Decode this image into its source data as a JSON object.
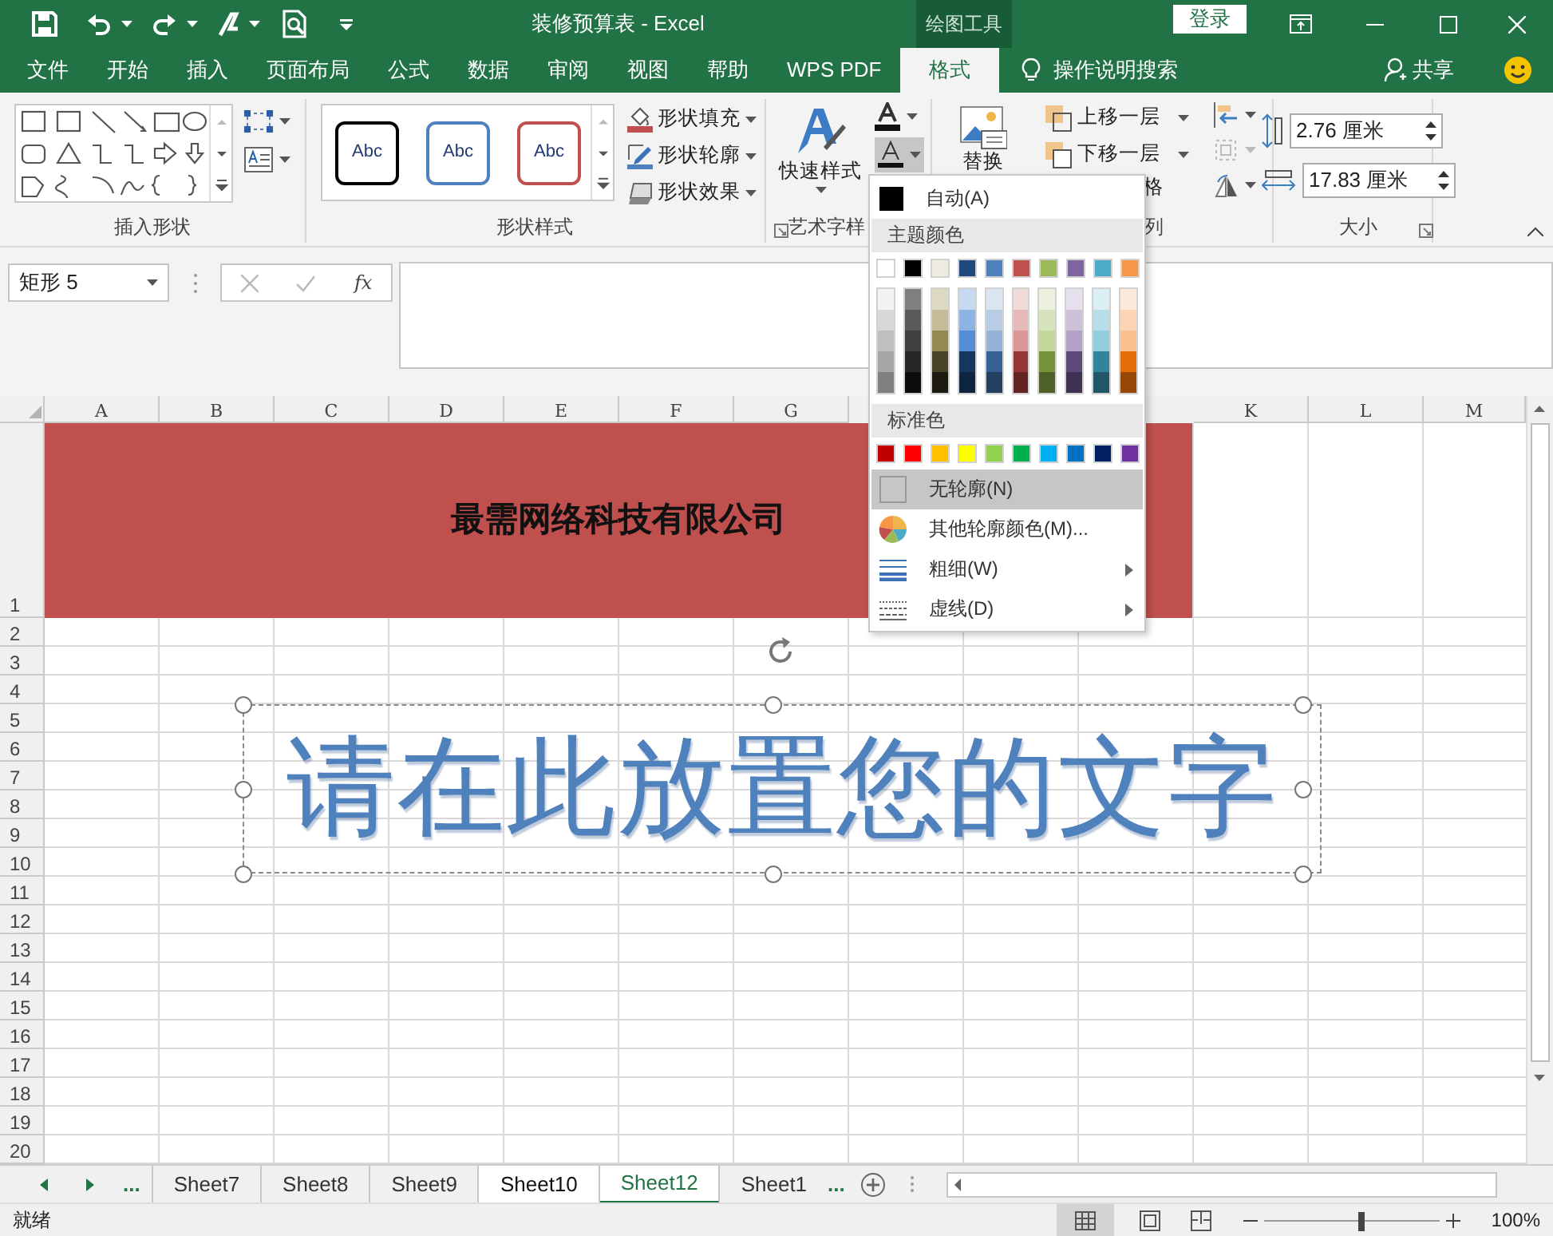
{
  "title_bar": {
    "title": "装修预算表  -  Excel",
    "context_tab": "绘图工具",
    "sign_in": "登录"
  },
  "ribbon_tabs": [
    {
      "label": "文件",
      "selected": false
    },
    {
      "label": "开始",
      "selected": false
    },
    {
      "label": "插入",
      "selected": false
    },
    {
      "label": "页面布局",
      "selected": false
    },
    {
      "label": "公式",
      "selected": false
    },
    {
      "label": "数据",
      "selected": false
    },
    {
      "label": "审阅",
      "selected": false
    },
    {
      "label": "视图",
      "selected": false
    },
    {
      "label": "帮助",
      "selected": false
    },
    {
      "label": "WPS PDF",
      "selected": false
    },
    {
      "label": "格式",
      "selected": true
    }
  ],
  "tell_me": "操作说明搜索",
  "share": "共享",
  "ribbon": {
    "insert_shapes": {
      "label": "插入形状"
    },
    "shape_styles": {
      "label": "形状样式",
      "presets": [
        {
          "text": "Abc",
          "color": "#000000"
        },
        {
          "text": "Abc",
          "color": "#4f81bd"
        },
        {
          "text": "Abc",
          "color": "#c0504d"
        }
      ],
      "commands": [
        {
          "label": "形状填充",
          "kind": "fill"
        },
        {
          "label": "形状轮廓",
          "kind": "outline"
        },
        {
          "label": "形状效果",
          "kind": "effect"
        }
      ]
    },
    "wordart": {
      "label": "艺术字样",
      "quick_styles": "快速样式"
    },
    "arrange": {
      "replace": "替换",
      "commands": [
        {
          "label": "上移一层",
          "kind": "forward"
        },
        {
          "label": "下移一层",
          "kind": "backward"
        }
      ],
      "pane_fragment": "格",
      "label": "列"
    },
    "size": {
      "label": "大小",
      "height": "2.76 厘米",
      "width": "17.83 厘米"
    }
  },
  "formula_bar": {
    "name_box": "矩形 5",
    "fx": "fx"
  },
  "sheet": {
    "columns_left": [
      "A",
      "B",
      "C",
      "D",
      "E",
      "F",
      "G"
    ],
    "columns_right": [
      "K",
      "L",
      "M"
    ],
    "rows": [
      "1",
      "2",
      "3",
      "4",
      "5",
      "6",
      "7",
      "8",
      "9",
      "10",
      "11",
      "12",
      "13",
      "14",
      "15",
      "16",
      "17",
      "18",
      "19",
      "20"
    ],
    "banner": "最需网络科技有限公司",
    "wordart_text": "请在此放置您的文字"
  },
  "outline_menu": {
    "automatic": "自动(A)",
    "theme_heading": "主题颜色",
    "theme_colors": [
      {
        "color": "#ffffff",
        "shades": [
          {
            "color": "#f2f2f2"
          },
          {
            "color": "#d8d8d8"
          },
          {
            "color": "#bfbfbf"
          },
          {
            "color": "#a5a5a5"
          },
          {
            "color": "#7f7f7f"
          }
        ]
      },
      {
        "color": "#000000",
        "shades": [
          {
            "color": "#7f7f7f"
          },
          {
            "color": "#595959"
          },
          {
            "color": "#3f3f3f"
          },
          {
            "color": "#262626"
          },
          {
            "color": "#0c0c0c"
          }
        ]
      },
      {
        "color": "#eeece1",
        "shades": [
          {
            "color": "#ddd9c3"
          },
          {
            "color": "#c4bd97"
          },
          {
            "color": "#938953"
          },
          {
            "color": "#494429"
          },
          {
            "color": "#1d1b10"
          }
        ]
      },
      {
        "color": "#1f497d",
        "shades": [
          {
            "color": "#c6d9f0"
          },
          {
            "color": "#8db3e2"
          },
          {
            "color": "#548dd4"
          },
          {
            "color": "#17365d"
          },
          {
            "color": "#0f243e"
          }
        ]
      },
      {
        "color": "#4f81bd",
        "shades": [
          {
            "color": "#dbe5f1"
          },
          {
            "color": "#b8cce4"
          },
          {
            "color": "#95b3d7"
          },
          {
            "color": "#366092"
          },
          {
            "color": "#244061"
          }
        ]
      },
      {
        "color": "#c0504d",
        "shades": [
          {
            "color": "#f2dcdb"
          },
          {
            "color": "#e5b9b7"
          },
          {
            "color": "#d99694"
          },
          {
            "color": "#953734"
          },
          {
            "color": "#632423"
          }
        ]
      },
      {
        "color": "#9bbb59",
        "shades": [
          {
            "color": "#ebf1dd"
          },
          {
            "color": "#d7e3bc"
          },
          {
            "color": "#c3d69b"
          },
          {
            "color": "#76923c"
          },
          {
            "color": "#4f6128"
          }
        ]
      },
      {
        "color": "#8064a2",
        "shades": [
          {
            "color": "#e5e0ec"
          },
          {
            "color": "#ccc1d9"
          },
          {
            "color": "#b2a2c7"
          },
          {
            "color": "#5f497a"
          },
          {
            "color": "#3f3151"
          }
        ]
      },
      {
        "color": "#4bacc6",
        "shades": [
          {
            "color": "#dbeef3"
          },
          {
            "color": "#b7dde8"
          },
          {
            "color": "#92cddc"
          },
          {
            "color": "#31859b"
          },
          {
            "color": "#205867"
          }
        ]
      },
      {
        "color": "#f79646",
        "shades": [
          {
            "color": "#fdeada"
          },
          {
            "color": "#fbd5b5"
          },
          {
            "color": "#fac08f"
          },
          {
            "color": "#e36c09"
          },
          {
            "color": "#974806"
          }
        ]
      }
    ],
    "standard_heading": "标准色",
    "standard_colors": [
      {
        "color": "#c00000"
      },
      {
        "color": "#ff0000"
      },
      {
        "color": "#ffc000"
      },
      {
        "color": "#ffff00"
      },
      {
        "color": "#92d050"
      },
      {
        "color": "#00b050"
      },
      {
        "color": "#00b0f0"
      },
      {
        "color": "#0070c0"
      },
      {
        "color": "#002060"
      },
      {
        "color": "#7030a0"
      }
    ],
    "items": [
      {
        "label": "无轮廓(N)",
        "kind": "none",
        "selected": true,
        "submenu": false
      },
      {
        "label": "其他轮廓颜色(M)...",
        "kind": "palette",
        "selected": false,
        "submenu": false
      },
      {
        "label": "粗细(W)",
        "kind": "weight",
        "selected": false,
        "submenu": true
      },
      {
        "label": "虚线(D)",
        "kind": "dash",
        "selected": false,
        "submenu": true
      }
    ]
  },
  "sheet_tabs": {
    "more_left": "...",
    "tabs": [
      {
        "label": "Sheet7",
        "selected": false,
        "active": false
      },
      {
        "label": "Sheet8",
        "selected": false,
        "active": false
      },
      {
        "label": "Sheet9",
        "selected": false,
        "active": false
      },
      {
        "label": "Sheet10",
        "selected": true,
        "active": false
      },
      {
        "label": "Sheet12",
        "selected": true,
        "active": true
      },
      {
        "label": "Sheet1",
        "selected": false,
        "active": false
      }
    ],
    "more_right": "..."
  },
  "status_bar": {
    "status": "就绪",
    "zoom": "100%",
    "zoom_slider": {
      "level": 0.55
    }
  }
}
